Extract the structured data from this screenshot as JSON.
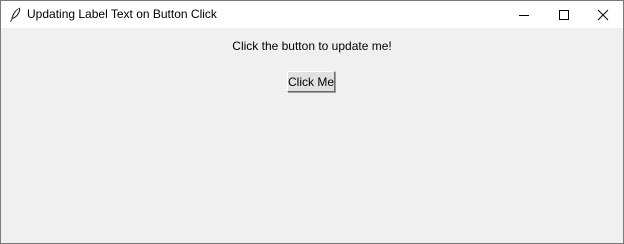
{
  "window": {
    "title": "Updating Label Text on Button Click",
    "icon": "feather-icon",
    "controls": {
      "minimize_icon": "minimize-icon",
      "maximize_icon": "maximize-icon",
      "close_icon": "close-icon"
    }
  },
  "main": {
    "label_text": "Click the button to update me!",
    "button_label": "Click Me"
  }
}
